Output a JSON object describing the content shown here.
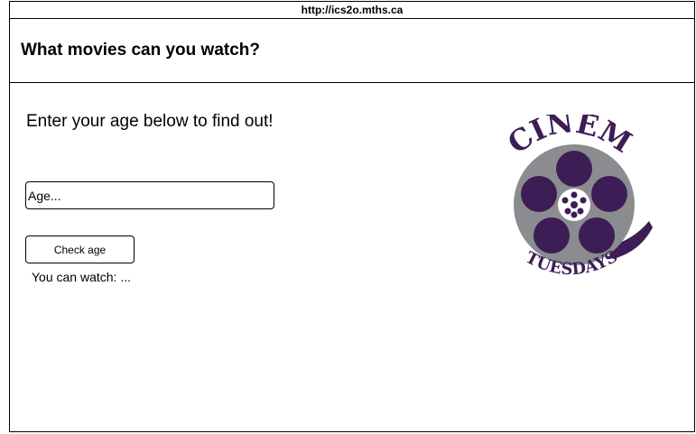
{
  "url_bar": {
    "url": "http://ics2o.mths.ca"
  },
  "header": {
    "title": "What movies can you watch?"
  },
  "main": {
    "prompt": "Enter your age below to find out!",
    "age_input": {
      "value": "",
      "placeholder": "Age..."
    },
    "check_button_label": "Check age",
    "result_text": "You can watch: ..."
  },
  "logo": {
    "top_word": "CINEMA",
    "bottom_word": "TUESDAYS",
    "colors": {
      "purple": "#3d1d55",
      "reel_gray": "#8a8c90"
    }
  }
}
